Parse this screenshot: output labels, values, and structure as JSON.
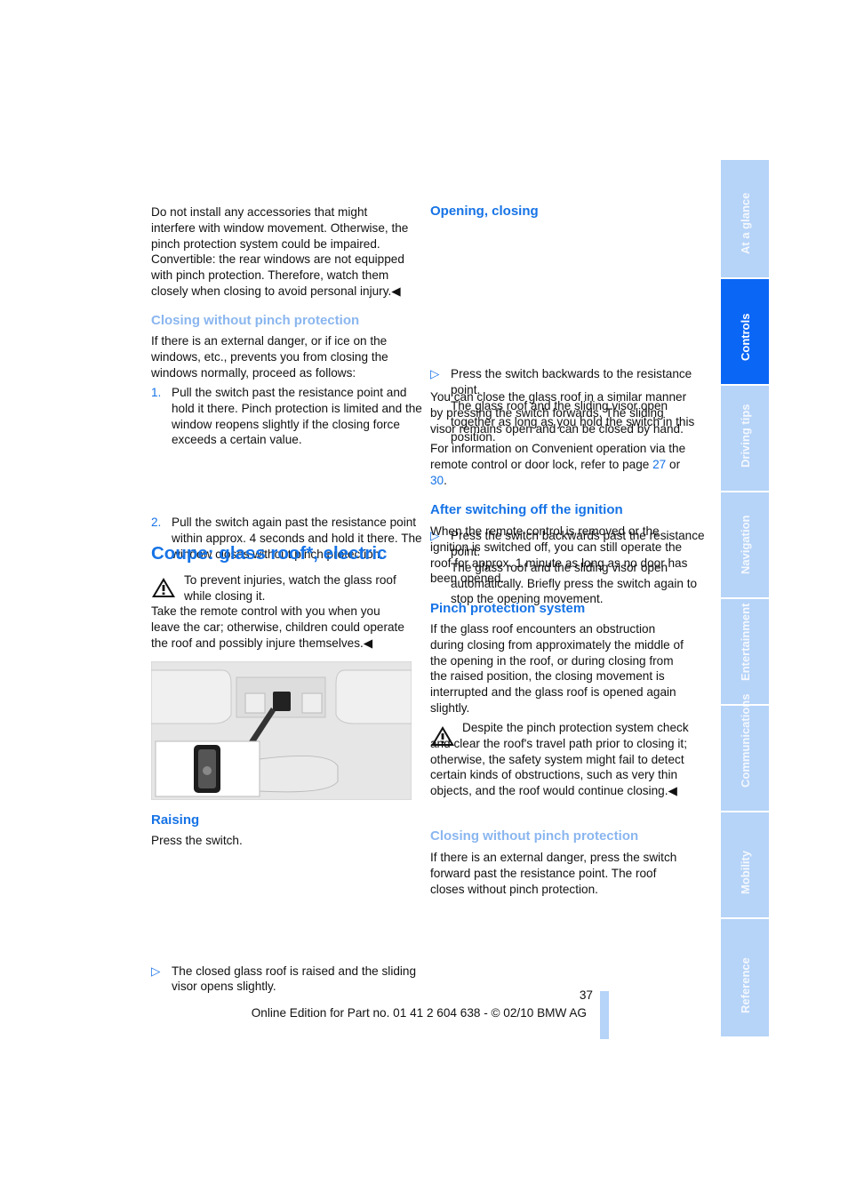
{
  "left": {
    "intro": "Do not install any accessories that might interfere with window movement. Otherwise, the pinch protection system could be impaired. Convertible: the rear windows are not equipped with pinch protection. Therefore, watch them closely when closing to avoid personal injury.◀",
    "closing_heading": "Closing without pinch protection",
    "closing_text": "If there is an external danger, or if ice on the windows, etc., prevents you from closing the windows normally, proceed as follows:",
    "steps": [
      {
        "num": "1.",
        "text": "Pull the switch past the resistance point and hold it there. Pinch protection is limited and the window reopens slightly if the closing force exceeds a certain value."
      },
      {
        "num": "2.",
        "text": "Pull the switch again past the resistance point within approx. 4 seconds and hold it there. The window closes without pinch protection."
      }
    ],
    "section_title": "Coupe: glass roof*, electric",
    "warning": "To prevent injuries, watch the glass roof while closing it.",
    "warning_cont": "Take the remote control with you when you leave the car; otherwise, children could operate the roof and possibly injure themselves.◀",
    "raising_heading": "Raising",
    "raising_text": "Press the switch.",
    "raising_bullet": "The closed glass roof is raised and the sliding visor opens slightly."
  },
  "right": {
    "opening_heading": "Opening, closing",
    "bullets": [
      {
        "a": "Press the switch backwards to the resistance point.",
        "b": "The glass roof and the sliding visor open together as long as you hold the switch in this position."
      },
      {
        "a": "Press the switch backwards past the resistance point.",
        "b": "The glass roof and the sliding visor open automatically. Briefly press the switch again to stop the opening movement."
      }
    ],
    "close_similar": "You can close the glass roof in a similar manner by pressing the switch forwards. The sliding visor remains open and can be closed by hand.",
    "info_pre": "For information on Convenient operation via the remote control or door lock, refer to page ",
    "info_page1": "27",
    "info_mid": " or ",
    "info_page2": "30",
    "info_end": ".",
    "after_heading": "After switching off the ignition",
    "after_text": "When the remote control is removed or the ignition is switched off, you can still operate the roof for approx. 1 minute as long as no door has been opened.",
    "pinch_heading": "Pinch protection system",
    "pinch_text": "If the glass roof encounters an obstruction during closing from approximately the middle of the opening in the roof, or during closing from the raised position, the closing movement is interrupted and the glass roof is opened again slightly.",
    "warning": "Despite the pinch protection system check and clear the roof's travel path prior to closing it; otherwise, the safety system might fail to detect certain kinds of obstructions, such as very thin objects, and the roof would continue closing.◀",
    "closing_heading": "Closing without pinch protection",
    "closing_text": "If there is an external danger, press the switch forward past the resistance point. The roof closes without pinch protection."
  },
  "tabs": [
    {
      "label": "At a glance",
      "active": false
    },
    {
      "label": "Controls",
      "active": true
    },
    {
      "label": "Driving tips",
      "active": false
    },
    {
      "label": "Navigation",
      "active": false
    },
    {
      "label": "Entertainment",
      "active": false
    },
    {
      "label": "Communications",
      "active": false
    },
    {
      "label": "Mobility",
      "active": false
    },
    {
      "label": "Reference",
      "active": false
    }
  ],
  "footer": {
    "page_number": "37",
    "edition": "Online Edition for Part no. 01 41 2 604 638 - © 02/10 BMW AG"
  },
  "colors": {
    "accent": "#1673e6",
    "tab_inactive": "#b6d3f8",
    "tab_active": "#0a66f5"
  }
}
